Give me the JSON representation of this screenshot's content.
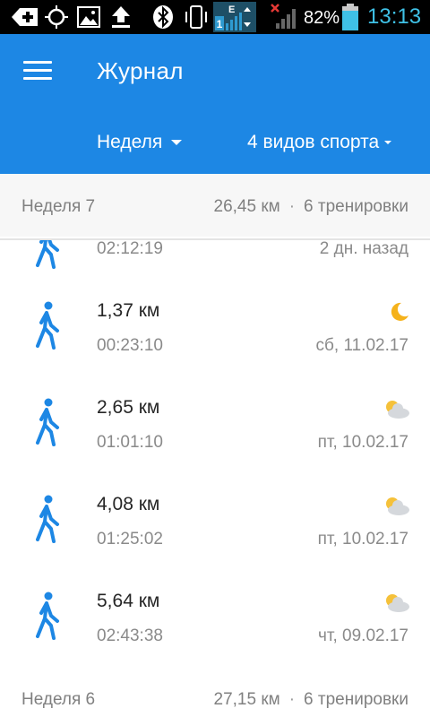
{
  "status_bar": {
    "battery": "82%",
    "time": "13:13",
    "network_letter": "E",
    "sim": "1"
  },
  "app_bar": {
    "title": "Журнал",
    "filter_period": "Неделя",
    "filter_sports": "4 видов спорта"
  },
  "weeks": [
    {
      "label": "Неделя 7",
      "distance": "26,45 км",
      "separator": "·",
      "workouts": "6 тренировки"
    },
    {
      "label": "Неделя 6",
      "distance": "27,15 км",
      "separator": "·",
      "workouts": "6 тренировки"
    }
  ],
  "activities": [
    {
      "distance": "",
      "duration": "02:12:19",
      "date": "2 дн. назад",
      "weather": ""
    },
    {
      "distance": "1,37 км",
      "duration": "00:23:10",
      "date": "сб, 11.02.17",
      "weather": "moon-icon"
    },
    {
      "distance": "2,65 км",
      "duration": "01:01:10",
      "date": "пт, 10.02.17",
      "weather": "partly-cloudy-icon"
    },
    {
      "distance": "4,08 км",
      "duration": "01:25:02",
      "date": "пт, 10.02.17",
      "weather": "partly-cloudy-icon"
    },
    {
      "distance": "5,64 км",
      "duration": "02:43:38",
      "date": "чт, 09.02.17",
      "weather": "partly-cloudy-icon"
    }
  ],
  "colors": {
    "accent": "#1d87e4",
    "icon_blue": "#1d87e4",
    "moon": "#f5b21b",
    "sun": "#f5c13a",
    "cloud": "#d5d8dc"
  }
}
